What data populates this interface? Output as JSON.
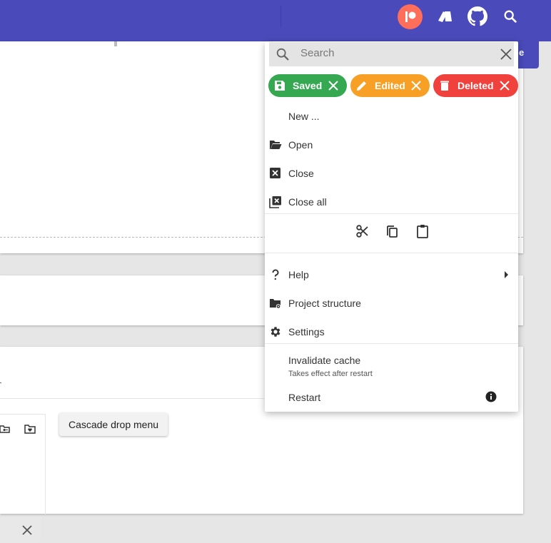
{
  "toolbar": {
    "icons": [
      "patreon-icon",
      "cards-icon",
      "github-icon",
      "search-icon"
    ],
    "brand_color": "#4a4aba"
  },
  "background": {
    "cascade_button_label": "Cascade drop menu",
    "chip_partial_letter": "e"
  },
  "menu": {
    "search": {
      "placeholder": "Search",
      "value": ""
    },
    "chips": [
      {
        "label": "Saved",
        "color": "#36a852",
        "icon": "save-icon"
      },
      {
        "label": "Edited",
        "color": "#f7a025",
        "icon": "pencil-icon"
      },
      {
        "label": "Deleted",
        "color": "#f0413c",
        "icon": "trash-icon"
      }
    ],
    "items": {
      "new": "New ...",
      "open": "Open",
      "close": "Close",
      "close_all": "Close all",
      "help": "Help",
      "project_structure": "Project structure",
      "settings": "Settings",
      "invalidate_cache": "Invalidate cache",
      "invalidate_cache_sub": "Takes effect after restart",
      "restart": "Restart"
    },
    "edit_tools": [
      "scissors-icon",
      "copy-icon",
      "paste-icon"
    ]
  }
}
